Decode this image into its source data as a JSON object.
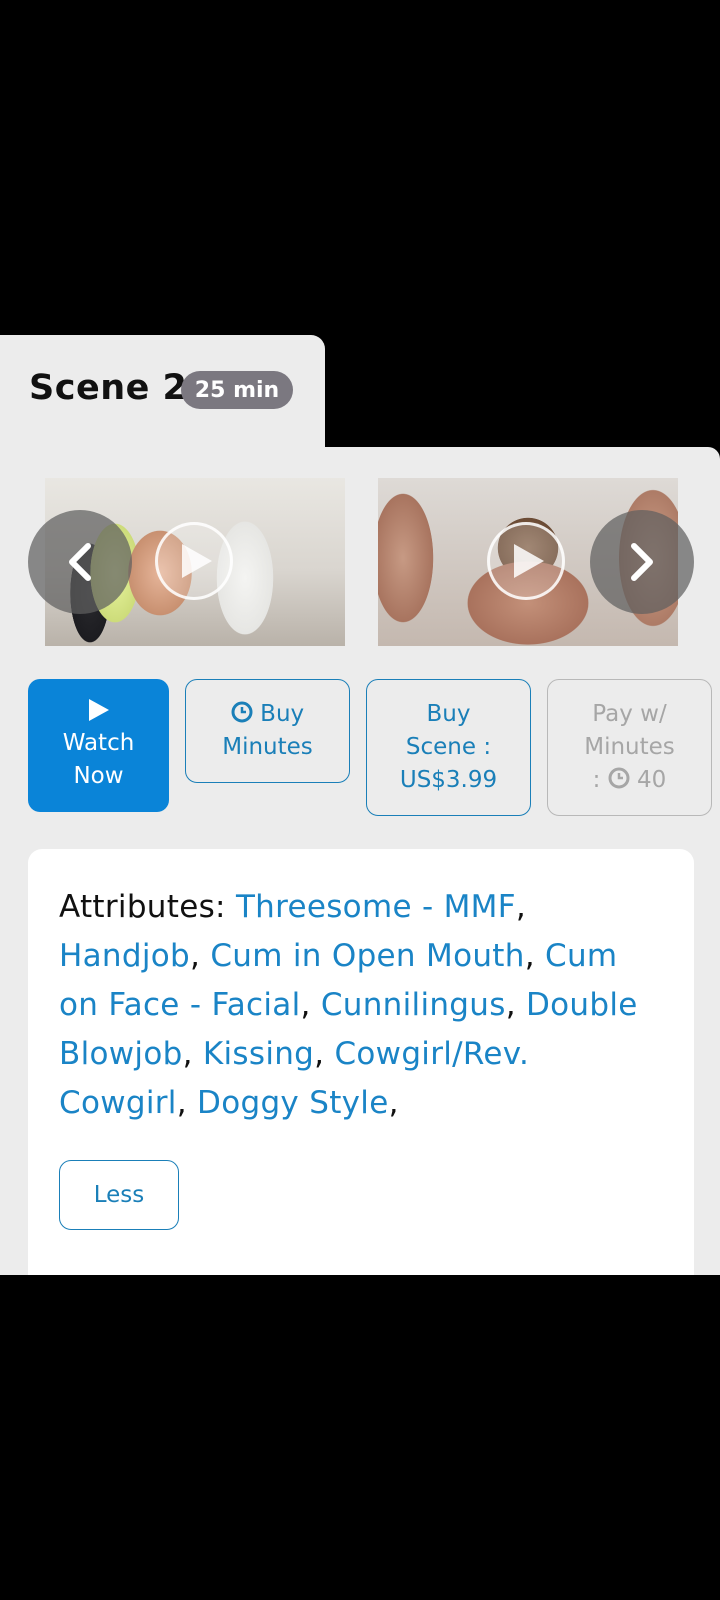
{
  "scene": {
    "title": "Scene 2",
    "duration": "25 min"
  },
  "carousel": {
    "prev_icon": "chevron-left-icon",
    "next_icon": "chevron-right-icon",
    "thumbnails": [
      {
        "play_icon": "play-icon"
      },
      {
        "play_icon": "play-icon"
      }
    ]
  },
  "actions": {
    "watch_line1": "Watch",
    "watch_line2": "Now",
    "buy_minutes_line1": "Buy",
    "buy_minutes_line2": "Minutes",
    "buy_scene_line1": "Buy",
    "buy_scene_line2": "Scene :",
    "buy_scene_price": "US$3.99",
    "pay_line1": "Pay w/",
    "pay_line2": "Minutes",
    "pay_prefix": ":",
    "pay_minutes": "40"
  },
  "attributes": {
    "label": "Attributes:",
    "items": [
      "Threesome - MMF",
      "Handjob",
      "Cum in Open Mouth",
      "Cum on Face - Facial",
      "Cunnilingus",
      "Double Blowjob",
      "Kissing",
      "Cowgirl/Rev. Cowgirl",
      "Doggy Style"
    ],
    "less_label": "Less"
  },
  "colors": {
    "accent": "#0a84d8",
    "link": "#1a84c6",
    "badge": "#7b7880",
    "panel": "#ececec",
    "disabled": "#a6a6a6"
  }
}
